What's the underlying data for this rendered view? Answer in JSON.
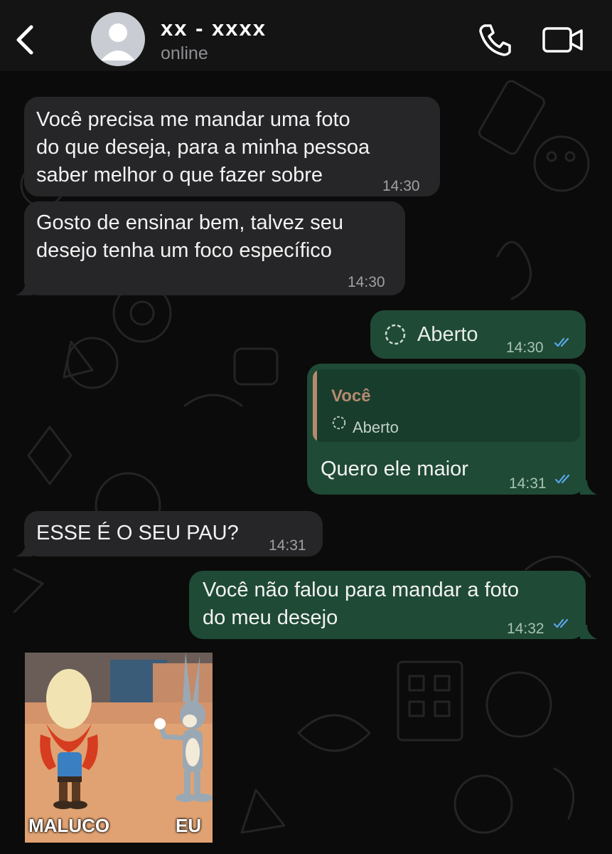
{
  "header": {
    "contact_name": "xx - xxxx",
    "status": "online"
  },
  "messages": [
    {
      "direction": "in",
      "text": "Você precisa me mandar uma foto\ndo que deseja, para a minha pessoa\nsaber melhor o que fazer sobre",
      "time": "14:30"
    },
    {
      "direction": "in",
      "text": "Gosto de ensinar bem, talvez seu\ndesejo tenha um foco específico",
      "time": "14:30"
    },
    {
      "direction": "out",
      "text": "Aberto",
      "time": "14:30",
      "read": true
    },
    {
      "direction": "out",
      "reply_to": {
        "author": "Você",
        "text": "Aberto"
      },
      "text": "Quero ele maior",
      "time": "14:31",
      "read": true
    },
    {
      "direction": "in",
      "text": "ESSE É O SEU PAU?",
      "time": "14:31"
    },
    {
      "direction": "out",
      "text": "Você não falou para mandar a foto\ndo meu desejo",
      "time": "14:32",
      "read": true
    }
  ],
  "sticker": {
    "left_caption": "MALUCO",
    "right_caption": "EU"
  },
  "colors": {
    "incoming_bubble": "#262628",
    "outgoing_bubble": "#1f4a36",
    "read_ticks": "#5aa7e8",
    "quote_author": "#b58a6e"
  },
  "icons": [
    "back-chevron-icon",
    "avatar-placeholder-icon",
    "phone-icon",
    "video-camera-icon",
    "view-once-icon",
    "double-check-icon"
  ]
}
